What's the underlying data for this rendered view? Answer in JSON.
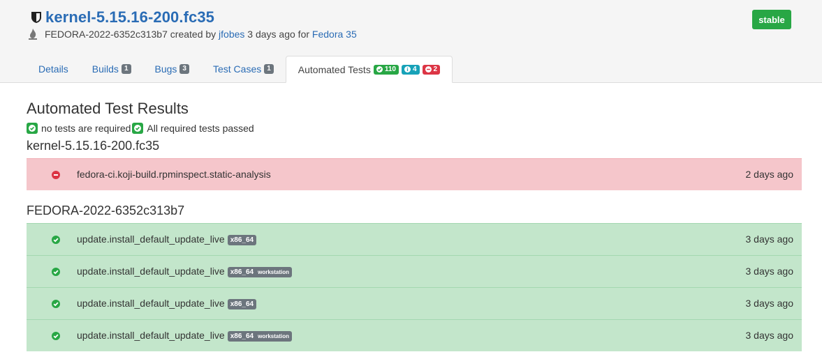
{
  "header": {
    "title": "kernel-5.15.16-200.fc35",
    "update_id": "FEDORA-2022-6352c313b7",
    "created_by_text": " created by ",
    "author": "jfobes",
    "age_text": " 3 days ago for ",
    "release": "Fedora 35",
    "status_badge": "stable"
  },
  "tabs": [
    {
      "label": "Details",
      "count": ""
    },
    {
      "label": "Builds",
      "count": "1"
    },
    {
      "label": "Bugs",
      "count": "3"
    },
    {
      "label": "Test Cases",
      "count": "1"
    },
    {
      "label": "Automated Tests",
      "passed": "110",
      "info": "4",
      "failed": "2"
    }
  ],
  "main": {
    "heading": "Automated Test Results",
    "requirements": [
      "no tests are required",
      "All required tests passed"
    ],
    "groups": [
      {
        "title": "kernel-5.15.16-200.fc35",
        "rows": [
          {
            "status": "fail",
            "name": "fedora-ci.koji-build.rpminspect.static-analysis",
            "arch": "",
            "flavor": "",
            "when": "2 days ago"
          }
        ]
      },
      {
        "title": "FEDORA-2022-6352c313b7",
        "rows": [
          {
            "status": "pass",
            "name": "update.install_default_update_live",
            "arch": "x86_64",
            "flavor": "",
            "when": "3 days ago"
          },
          {
            "status": "pass",
            "name": "update.install_default_update_live",
            "arch": "x86_64",
            "flavor": "workstation",
            "when": "3 days ago"
          },
          {
            "status": "pass",
            "name": "update.install_default_update_live",
            "arch": "x86_64",
            "flavor": "",
            "when": "3 days ago"
          },
          {
            "status": "pass",
            "name": "update.install_default_update_live",
            "arch": "x86_64",
            "flavor": "workstation",
            "when": "3 days ago"
          }
        ]
      }
    ]
  },
  "colors": {
    "link": "#2a6cb5",
    "success": "#28a745",
    "danger": "#dc3545",
    "info": "#17a2b8",
    "fail_row_bg": "#f5c6cb",
    "pass_row_bg": "#c3e6cb"
  },
  "icons": {
    "title": "shield-icon",
    "submitter": "fire-icon",
    "pass": "check-circle-icon",
    "fail": "minus-circle-icon",
    "info": "info-circle-icon"
  }
}
